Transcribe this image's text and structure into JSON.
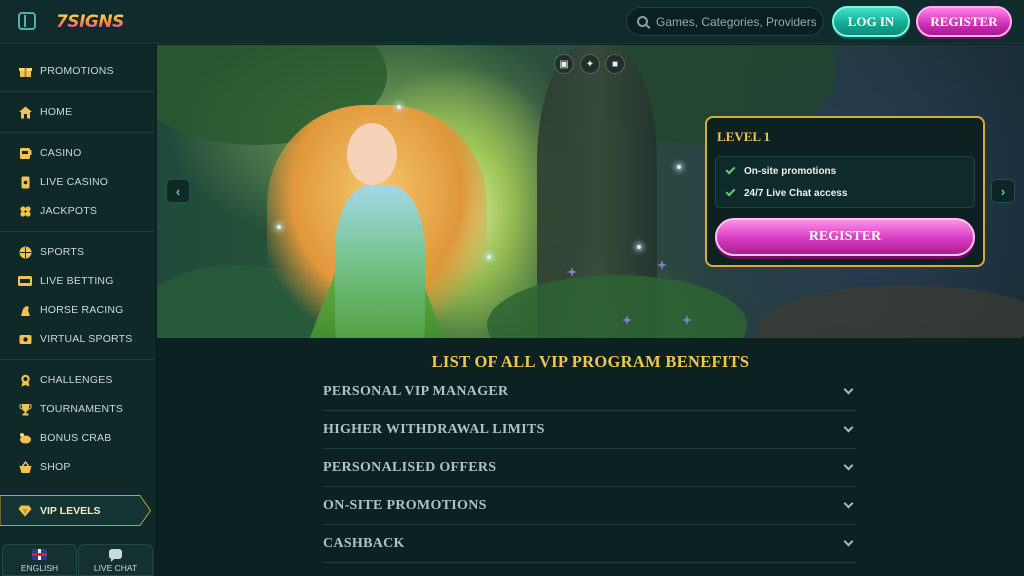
{
  "header": {
    "logo_text": "7SIGNS",
    "search_placeholder": "Games, Categories, Providers",
    "login_label": "LOG IN",
    "register_label": "REGISTER"
  },
  "sidebar": {
    "items": [
      {
        "label": "PROMOTIONS",
        "icon": "gift-icon"
      },
      {
        "label": "HOME",
        "icon": "home-icon"
      },
      {
        "label": "CASINO",
        "icon": "slot-machine-icon"
      },
      {
        "label": "LIVE CASINO",
        "icon": "card-icon"
      },
      {
        "label": "JACKPOTS",
        "icon": "clover-icon"
      },
      {
        "label": "SPORTS",
        "icon": "ball-icon"
      },
      {
        "label": "LIVE BETTING",
        "icon": "live-icon"
      },
      {
        "label": "HORSE RACING",
        "icon": "horse-icon"
      },
      {
        "label": "VIRTUAL SPORTS",
        "icon": "virtual-icon"
      },
      {
        "label": "CHALLENGES",
        "icon": "medal-icon"
      },
      {
        "label": "TOURNAMENTS",
        "icon": "trophy-icon"
      },
      {
        "label": "BONUS CRAB",
        "icon": "crab-icon"
      },
      {
        "label": "SHOP",
        "icon": "basket-icon"
      }
    ],
    "vip_label": "VIP LEVELS",
    "language_label": "ENGLISH",
    "chat_label": "LIVE CHAT"
  },
  "level_card": {
    "title": "LEVEL 1",
    "benefits": [
      "On-site promotions",
      "24/7 Live Chat access"
    ],
    "register_label": "REGISTER"
  },
  "benefits_section": {
    "title": "LIST OF ALL VIP PROGRAM BENEFITS",
    "items": [
      "PERSONAL VIP MANAGER",
      "HIGHER WITHDRAWAL LIMITS",
      "PERSONALISED OFFERS",
      "ON-SITE PROMOTIONS",
      "CASHBACK"
    ]
  },
  "colors": {
    "accent_gold": "#f0c650",
    "login_teal": "#14a893",
    "register_pink": "#d12fb8",
    "background": "#0c2222"
  }
}
